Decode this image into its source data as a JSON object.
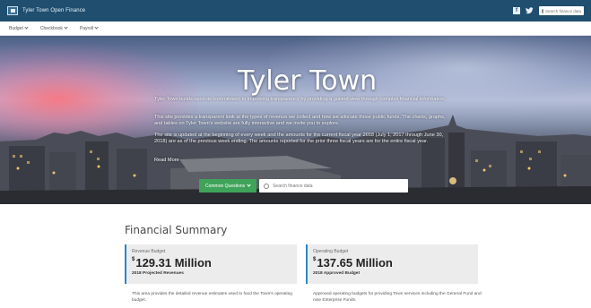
{
  "app": {
    "title": "Tyler Town Open Finance"
  },
  "topbar": {
    "facebook_glyph": "f",
    "search_placeholder": "Search finance data"
  },
  "nav": {
    "items": [
      {
        "label": "Budget"
      },
      {
        "label": "Checkbook"
      },
      {
        "label": "Payroll"
      }
    ]
  },
  "hero": {
    "title": "Tyler Town",
    "paragraphs": [
      "Tyler Town builds upon its commitment to improving transparency by providing a guided view through complex financial information.",
      "This site provides a transparent look at the types of revenue we collect and how we allocate those public funds. The charts, graphs, and tables on Tyler Town's website are fully interactive and we invite you to explore.",
      "The site is updated at the beginning of every week and the amounts for the current fiscal year 2018 (July 1, 2017 through June 30, 2018) are as of the previous week ending. The amounts reported for the prior three fiscal years are for the entire fiscal year."
    ],
    "read_more": "Read More",
    "common_questions_label": "Common Questions",
    "search_placeholder": "Search finance data"
  },
  "summary": {
    "title": "Financial Summary",
    "cards": [
      {
        "label": "Revenue Budget",
        "currency": "$",
        "value": "129.31 Million",
        "subtitle": "2018 Projected Revenues",
        "description": "This area provides the detailed revenue estimates used to fund the Town's operating budget."
      },
      {
        "label": "Operating Budget",
        "currency": "$",
        "value": "137.65 Million",
        "subtitle": "2018 Approved Budget",
        "description": "Approved operating budgets for providing Town services including the General Fund and nine Enterprise Funds."
      }
    ]
  },
  "colors": {
    "topbar": "#1f4e6e",
    "accent_green": "#3fa45a",
    "card_border": "#2b87c6",
    "card_bg": "#ececec"
  }
}
